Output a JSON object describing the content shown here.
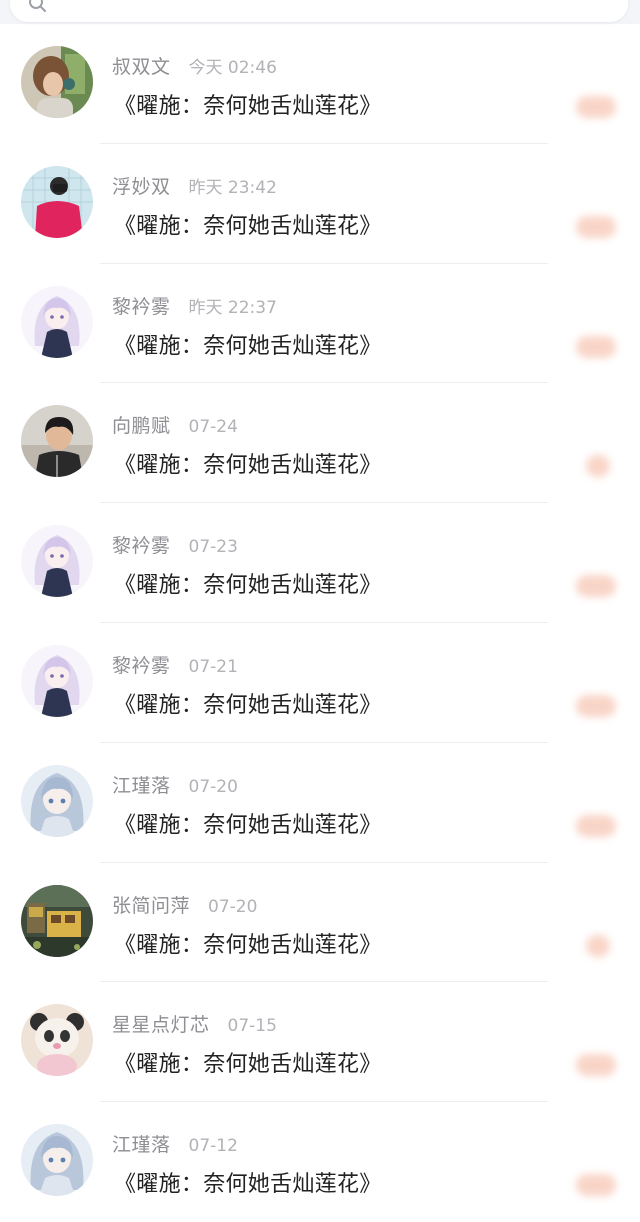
{
  "search": {
    "icon": "search-icon"
  },
  "items": [
    {
      "name": "叔双文",
      "time": "今天 02:46",
      "message": "《曜施：奈何她舌灿莲花》",
      "badge": "",
      "avatar": "photo-girl"
    },
    {
      "name": "浮妙双",
      "time": "昨天 23:42",
      "message": "《曜施：奈何她舌灿莲花》",
      "badge": "",
      "avatar": "photo-red"
    },
    {
      "name": "黎衿雾",
      "time": "昨天 22:37",
      "message": "《曜施：奈何她舌灿莲花》",
      "badge": "",
      "avatar": "anime-purple"
    },
    {
      "name": "向鹏赋",
      "time": "07-24",
      "message": "《曜施：奈何她舌灿莲花》",
      "badge": "",
      "avatar": "photo-boy"
    },
    {
      "name": "黎衿雾",
      "time": "07-23",
      "message": "《曜施：奈何她舌灿莲花》",
      "badge": "",
      "avatar": "anime-purple"
    },
    {
      "name": "黎衿雾",
      "time": "07-21",
      "message": "《曜施：奈何她舌灿莲花》",
      "badge": "",
      "avatar": "anime-purple"
    },
    {
      "name": "江瑾落",
      "time": "07-20",
      "message": "《曜施：奈何她舌灿莲花》",
      "badge": "",
      "avatar": "anime-blue"
    },
    {
      "name": "张简问萍",
      "time": "07-20",
      "message": "《曜施：奈何她舌灿莲花》",
      "badge": "",
      "avatar": "pixel-scene"
    },
    {
      "name": "星星点灯芯",
      "time": "07-15",
      "message": "《曜施：奈何她舌灿莲花》",
      "badge": "",
      "avatar": "panda-plush"
    },
    {
      "name": "江瑾落",
      "time": "07-12",
      "message": "《曜施：奈何她舌灿莲花》",
      "badge": "",
      "avatar": "anime-blue"
    }
  ],
  "colors": {
    "accent_badge": "#f5b9a3",
    "name": "#8e8e93",
    "time": "#b2b2b7",
    "message": "#222222"
  }
}
